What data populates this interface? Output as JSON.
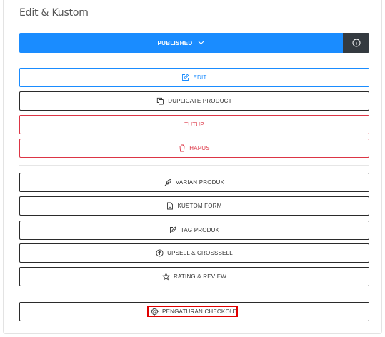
{
  "panel": {
    "title": "Edit & Kustom"
  },
  "publish": {
    "label": "PUBLISHED",
    "dropdown_icon": "chevron-down-icon",
    "info_icon": "info-icon"
  },
  "actions": {
    "edit": {
      "label": "EDIT",
      "icon": "pencil-square-icon"
    },
    "duplicate": {
      "label": "DUPLICATE PRODUCT",
      "icon": "copy-icon"
    },
    "tutup": {
      "label": "TUTUP"
    },
    "hapus": {
      "label": "HAPUS",
      "icon": "trash-icon"
    }
  },
  "settings": {
    "varian": {
      "label": "VARIAN PRODUK",
      "icon": "feather-icon"
    },
    "kustom_form": {
      "label": "KUSTOM FORM",
      "icon": "document-icon"
    },
    "tag": {
      "label": "TAG PRODUK",
      "icon": "pencil-square-icon"
    },
    "upsell": {
      "label": "UPSELL & CROSSSELL",
      "icon": "arrow-up-circle-icon"
    },
    "rating": {
      "label": "RATING & REVIEW",
      "icon": "star-icon"
    },
    "checkout": {
      "label": "PENGATURAN CHECKOUT",
      "icon": "gear-icon"
    }
  },
  "colors": {
    "primary": "#1a8cff",
    "danger": "#dc3545",
    "dark": "#343a40",
    "highlight": "#e00000"
  }
}
